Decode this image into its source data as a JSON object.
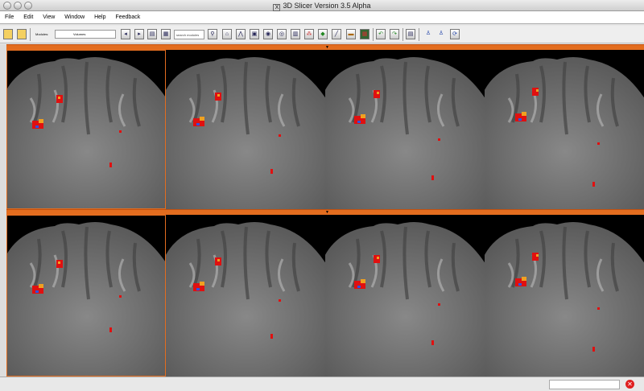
{
  "window": {
    "title": "3D Slicer Version 3.5 Alpha"
  },
  "menu": [
    "File",
    "Edit",
    "View",
    "Window",
    "Help",
    "Feedback"
  ],
  "toolbar": {
    "modules_label": "Modules:",
    "module_selected": "Volumes",
    "search_placeholder": "search modules"
  },
  "colors": {
    "accent": "#e36d1f",
    "lesion_red": "#e01010",
    "lesion_orange": "#f0a020"
  }
}
